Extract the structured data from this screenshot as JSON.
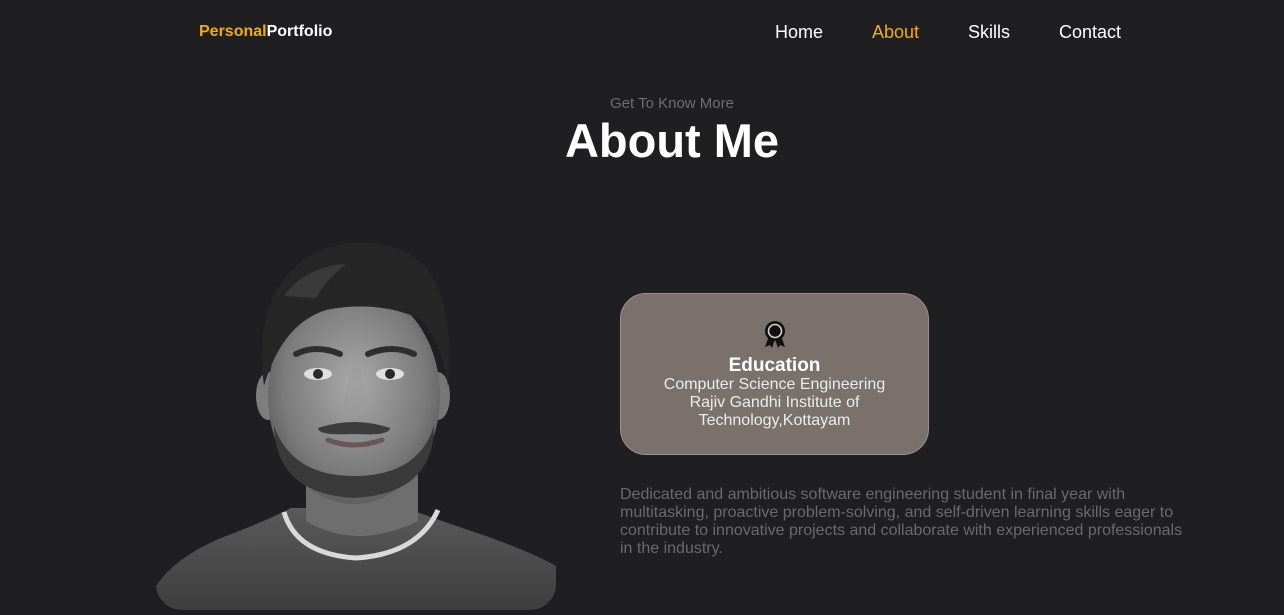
{
  "header": {
    "logo_accent": "Personal",
    "logo_rest": "Portfolio",
    "nav": [
      {
        "label": "Home",
        "active": false
      },
      {
        "label": "About",
        "active": true
      },
      {
        "label": "Skills",
        "active": false
      },
      {
        "label": "Contact",
        "active": false
      }
    ]
  },
  "about": {
    "eyebrow": "Get To Know More",
    "title": "About Me",
    "education": {
      "icon": "award-icon",
      "title": "Education",
      "line1": "Computer Science Engineering",
      "line2": "Rajiv Gandhi Institute of",
      "line3": "Technology,Kottayam"
    },
    "description": "Dedicated and ambitious software engineering student in final year with multitasking, proactive problem-solving, and self-driven learning skills eager to contribute to innovative projects and collaborate with experienced professionals in the industry."
  },
  "colors": {
    "background": "#1f1f21",
    "accent": "#f2aa1c",
    "card": "#7a706c",
    "muted_text": "#6a6a6e"
  }
}
